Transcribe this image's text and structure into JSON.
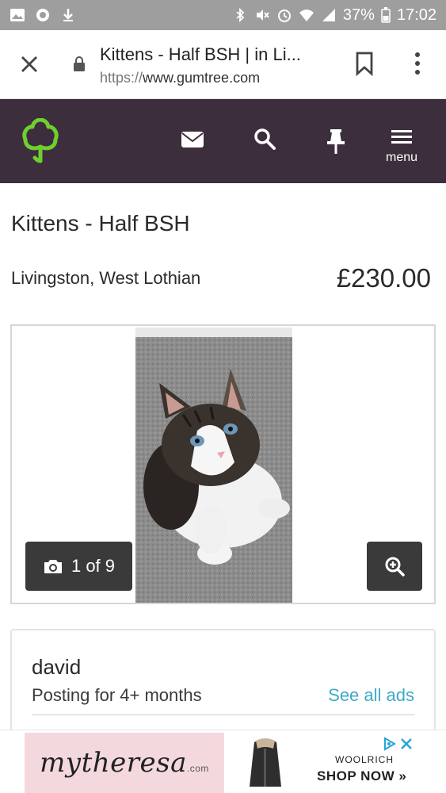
{
  "status_bar": {
    "battery": "37%",
    "time": "17:02"
  },
  "chrome": {
    "page_title": "Kittens - Half BSH | in Li...",
    "url_protocol": "https://",
    "url_domain": "www.gumtree.com"
  },
  "header": {
    "menu_label": "menu"
  },
  "listing": {
    "title": "Kittens - Half BSH",
    "location": "Livingston, West Lothian",
    "price": "£230.00",
    "photo_counter": "1 of 9"
  },
  "seller": {
    "name": "david",
    "since": "Posting for 4+ months",
    "see_all_label": "See all ads"
  },
  "ad": {
    "brand": "mytheresa",
    "brand_suffix": ".com",
    "woolrich": "WOOLRICH",
    "shop_now": "SHOP NOW »"
  },
  "colors": {
    "header_bg": "#3c2e3c",
    "logo_green": "#6fcf2e",
    "link_blue": "#3fa9c9"
  },
  "icons": [
    "close-icon",
    "lock-icon",
    "bookmark-icon",
    "more-vert-icon",
    "gumtree-logo-icon",
    "mail-icon",
    "search-icon",
    "pin-icon",
    "hamburger-menu-icon",
    "camera-icon",
    "zoom-in-icon",
    "ad-choices-icon"
  ]
}
